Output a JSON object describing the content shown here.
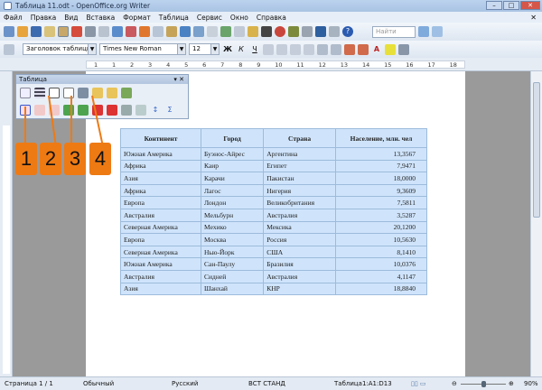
{
  "window": {
    "title": "Таблица 11.odt - OpenOffice.org Writer",
    "minimize": "–",
    "maximize": "□",
    "close": "✕"
  },
  "menu": [
    "Файл",
    "Правка",
    "Вид",
    "Вставка",
    "Формат",
    "Таблица",
    "Сервис",
    "Окно",
    "Справка"
  ],
  "menu_close": "✕",
  "format": {
    "style": "Заголовок таблицы",
    "font": "Times New Roman",
    "size": "12",
    "bold": "Ж",
    "italic": "К",
    "underline": "Ч"
  },
  "search": {
    "placeholder": "Найти"
  },
  "ruler_numbers": [
    "1",
    "1",
    "2",
    "3",
    "4",
    "5",
    "6",
    "7",
    "8",
    "9",
    "10",
    "11",
    "12",
    "13",
    "14",
    "15",
    "16",
    "17",
    "18"
  ],
  "table_toolbar": {
    "title": "Таблица"
  },
  "callouts": [
    "1",
    "2",
    "3",
    "4"
  ],
  "table": {
    "headers": [
      "Континент",
      "Город",
      "Страна",
      "Население, млн. чел"
    ],
    "rows": [
      [
        "Южная Америка",
        "Буэнос-Айрес",
        "Аргентина",
        "13,3567"
      ],
      [
        "Африка",
        "Каир",
        "Египет",
        "7,9471"
      ],
      [
        "Азия",
        "Карачи",
        "Пакистан",
        "18,0000"
      ],
      [
        "Африка",
        "Лагос",
        "Нигерия",
        "9,3609"
      ],
      [
        "Европа",
        "Лондон",
        "Великобритания",
        "7,5811"
      ],
      [
        "Австралия",
        "Мельбурн",
        "Австралия",
        "3,5287"
      ],
      [
        "Северная Америка",
        "Мехико",
        "Мексика",
        "20,1200"
      ],
      [
        "Европа",
        "Москва",
        "Россия",
        "10,5630"
      ],
      [
        "Северная Америка",
        "Нью-Йорк",
        "США",
        "8,1410"
      ],
      [
        "Южная Америка",
        "Сан-Паулу",
        "Бразилия",
        "10,0376"
      ],
      [
        "Австралия",
        "Сидней",
        "Австралия",
        "4,1147"
      ],
      [
        "Азия",
        "Шанхай",
        "КНР",
        "18,8840"
      ]
    ]
  },
  "status": {
    "page": "Страница 1 / 1",
    "style": "Обычный",
    "lang": "Русский",
    "mode": "ВСТ  СТАНД",
    "cell": "Таблица1:A1:D13",
    "zoom": "90%",
    "zoom_value": 90
  }
}
